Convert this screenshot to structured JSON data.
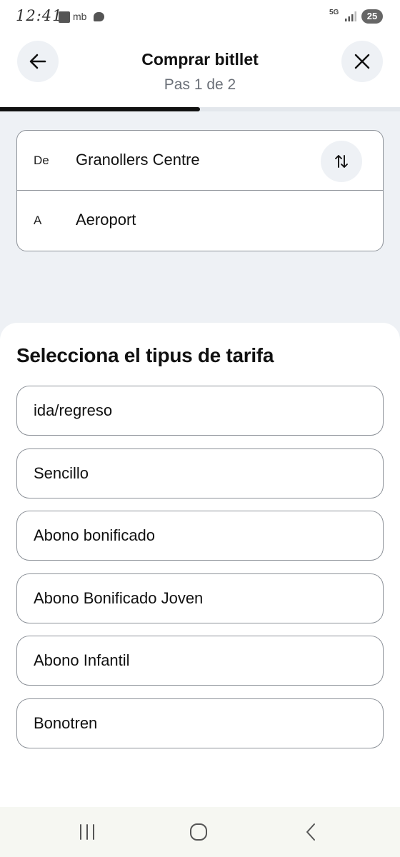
{
  "status_bar": {
    "time": "12:41",
    "carrier": "mb",
    "network": "5G",
    "battery": "25"
  },
  "header": {
    "title": "Comprar bitllet",
    "step": "Pas 1 de 2",
    "back_icon": "arrow-left-icon",
    "close_icon": "close-icon"
  },
  "progress": {
    "current_step": 1,
    "total_steps": 2,
    "fraction": 0.5
  },
  "route": {
    "from_label": "De",
    "from_value": "Granollers Centre",
    "to_label": "A",
    "to_value": "Aeroport",
    "swap_icon": "swap-vertical-icon"
  },
  "fare_section": {
    "title": "Selecciona el tipus de tarifa",
    "options": [
      "ida/regreso",
      "Sencillo",
      "Abono bonificado",
      "Abono Bonificado Joven",
      "Abono Infantil",
      "Bonotren"
    ]
  },
  "nav_bar": {
    "recents_icon": "recents-icon",
    "home_icon": "home-icon",
    "back_icon": "nav-back-icon"
  },
  "colors": {
    "accent": "#111111",
    "panel_bg": "#eef1f5",
    "border": "#8d9299",
    "muted_text": "#6b7078"
  }
}
